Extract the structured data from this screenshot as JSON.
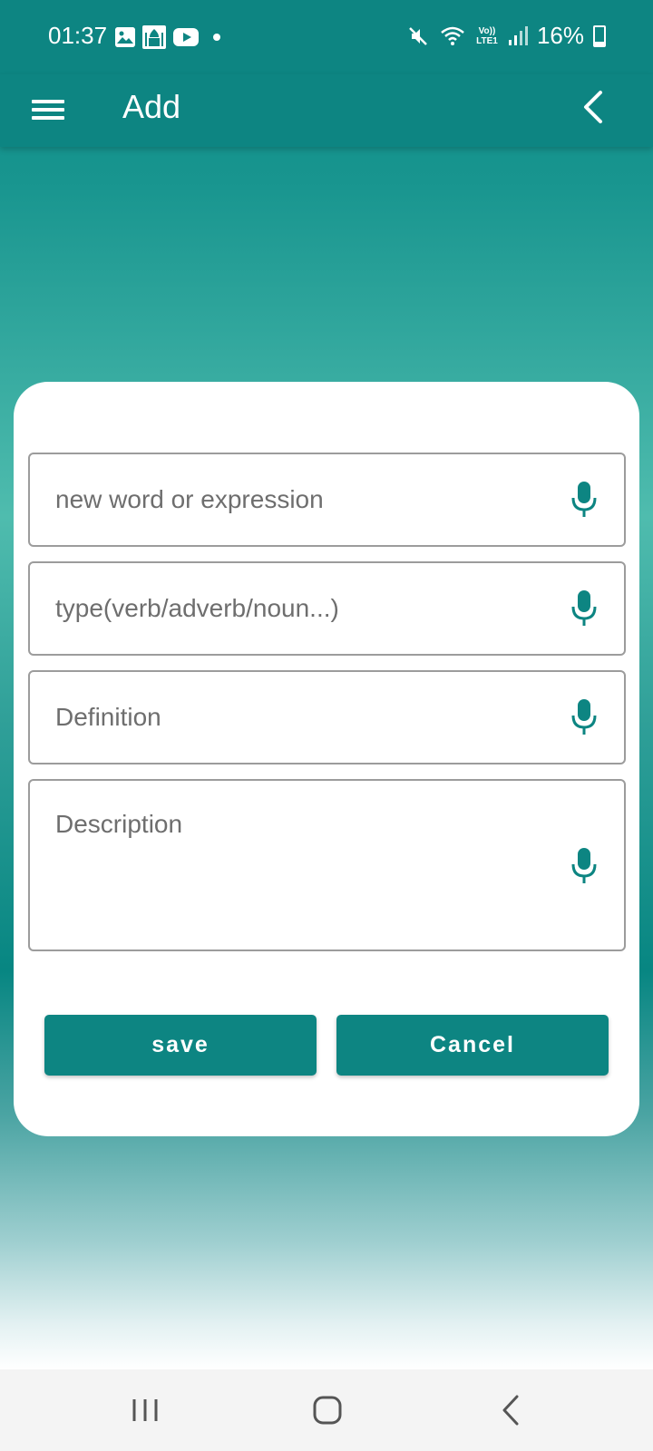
{
  "status_bar": {
    "time": "01:37",
    "left_icons": [
      "gallery-icon",
      "prayer-app-icon",
      "youtube-icon",
      "notification-dot-icon"
    ],
    "right_icons": [
      "mute-icon",
      "wifi-icon",
      "volte-lte-icon",
      "signal-icon",
      "battery-icon"
    ],
    "volte_label": "Vo)) LTE1",
    "battery": "16%"
  },
  "app_bar": {
    "title": "Add",
    "menu_icon": "hamburger-menu-icon",
    "back_icon": "chevron-left-icon"
  },
  "form": {
    "word_placeholder": "new word or expression",
    "type_placeholder": "type(verb/adverb/noun...)",
    "definition_placeholder": "Definition",
    "description_placeholder": "Description",
    "mic_icon": "microphone-icon"
  },
  "buttons": {
    "save_label": "save",
    "cancel_label": "Cancel"
  },
  "colors": {
    "primary": "#0d8582",
    "field_border": "#9c9c9c",
    "placeholder": "#6e6e6e"
  },
  "nav_bar": {
    "icons": [
      "recent-apps-icon",
      "home-icon",
      "back-icon"
    ]
  }
}
